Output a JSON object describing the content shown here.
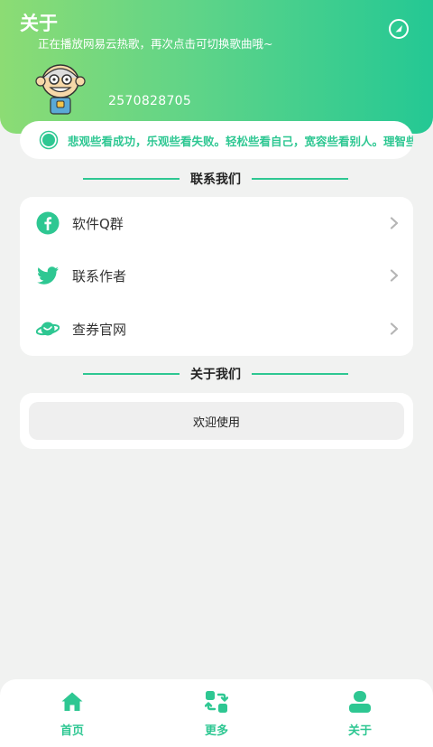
{
  "header": {
    "title": "关于",
    "subtitle": "正在播放网易云热歌，再次点击可切换歌曲哦~",
    "user_id": "2570828705"
  },
  "notice": {
    "text": "悲观些看成功，乐观些看失败。轻松些看自己，宽容些看别人。理智些看问题"
  },
  "contact_section": {
    "heading": "联系我们",
    "items": [
      {
        "label": "软件Q群",
        "icon": "facebook-icon"
      },
      {
        "label": "联系作者",
        "icon": "twitter-icon"
      },
      {
        "label": "查券官网",
        "icon": "planet-icon"
      }
    ]
  },
  "about_section": {
    "heading": "关于我们",
    "button_label": "欢迎使用"
  },
  "tabbar": {
    "tabs": [
      {
        "label": "首页",
        "icon": "home-icon"
      },
      {
        "label": "更多",
        "icon": "swap-icon"
      },
      {
        "label": "关于",
        "icon": "user-icon"
      }
    ]
  },
  "colors": {
    "accent": "#2ec792",
    "gradient_start": "#8cdc74",
    "gradient_end": "#24c894"
  }
}
